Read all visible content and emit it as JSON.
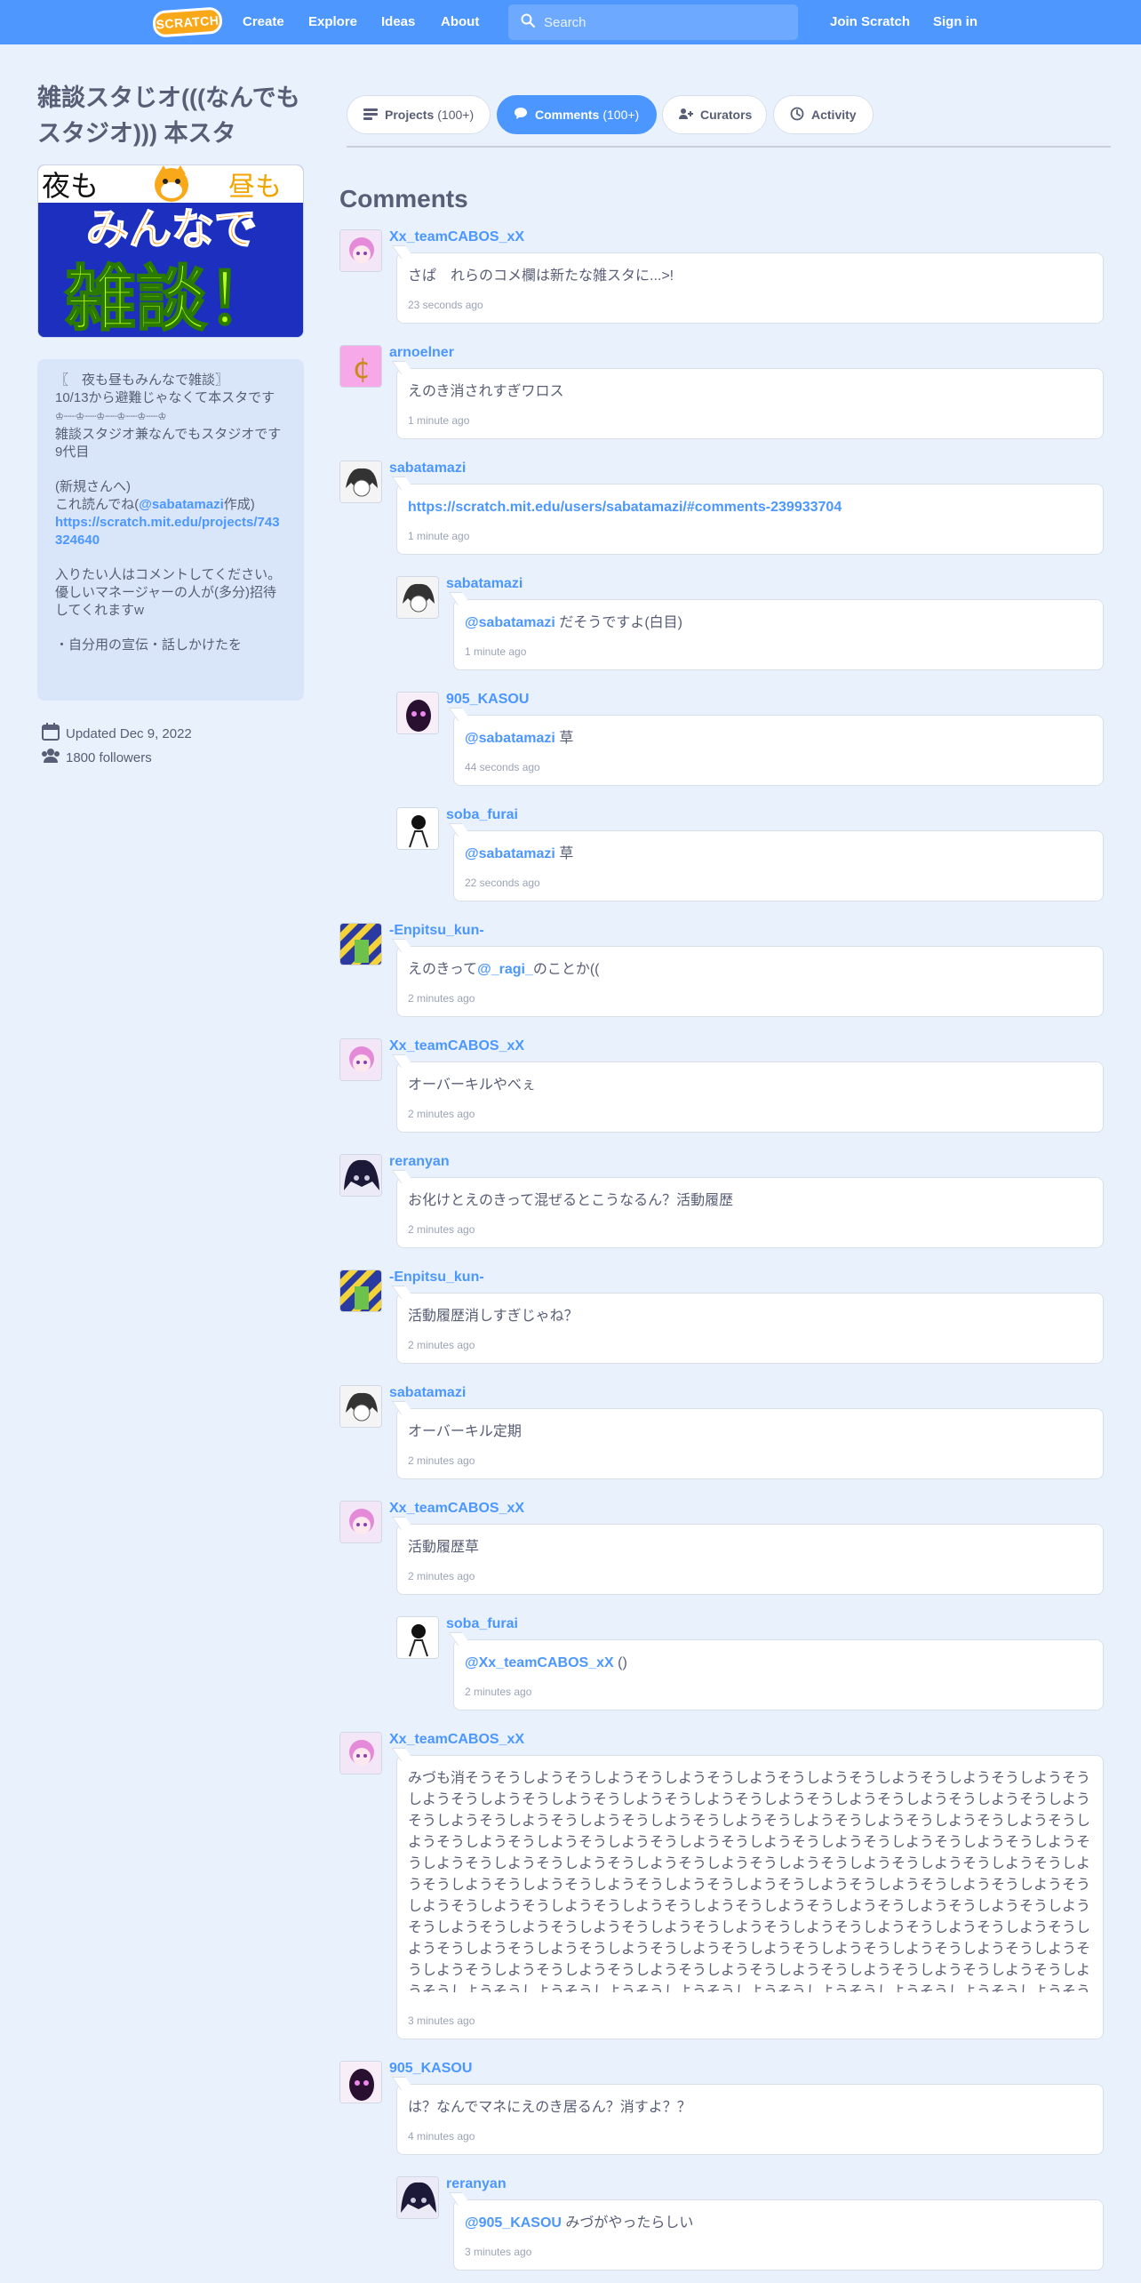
{
  "nav": {
    "logo": "SCRATCH",
    "create": "Create",
    "explore": "Explore",
    "ideas": "Ideas",
    "about": "About",
    "search_placeholder": "Search",
    "join": "Join Scratch",
    "signin": "Sign in"
  },
  "studio": {
    "title": "雑談スタじオ(((なんでもスタジオ))) 本スタ",
    "thumbnail_text": {
      "top_left": "夜も",
      "top_right": "昼も",
      "middle": "みんなで",
      "bottom": "雑談！"
    },
    "description": {
      "p1_line1": "〖　夜も昼もみんなで雑談〗",
      "p1_line2": "10/13から避難じゃなくて本スタです",
      "p1_line3": "♔┈┈♔┈┈♔┈┈♔┈┈♔┈┈♔",
      "p1_line4": "雑談スタジオ兼なんでもスタジオです",
      "p1_line5": "9代目",
      "p2_line1": "(新規さんへ)",
      "p2_prefix": "これ読んでね(",
      "p2_mention": "@sabatamazi",
      "p2_suffix": "作成)",
      "p2_link": "https://scratch.mit.edu/projects/743324640",
      "p3_line1": "入りたい人はコメントしてください。",
      "p3_line2": "優しいマネージャーの人が(多分)招待してくれますw",
      "p4_line1": "・自分用の宣伝・話しかけたを"
    },
    "updated": "Updated Dec 9, 2022",
    "followers": "1800 followers"
  },
  "tabs": [
    {
      "label": "Projects",
      "count": "(100+)"
    },
    {
      "label": "Comments",
      "count": "(100+)"
    },
    {
      "label": "Curators",
      "count": ""
    },
    {
      "label": "Activity",
      "count": ""
    }
  ],
  "comments_heading": "Comments",
  "comments": [
    {
      "user": "Xx_teamCABOS_xX",
      "text": "さぱ　れらのコメ欄は新たな雑スタに...>!",
      "time": "23 seconds ago"
    },
    {
      "user": "arnoelner",
      "text": "えのき消されすぎワロス",
      "time": "1 minute ago"
    },
    {
      "user": "sabatamazi",
      "text": "",
      "link": "https://scratch.mit.edu/users/sabatamazi/#comments-239933704",
      "time": "1 minute ago"
    },
    {
      "user": "sabatamazi",
      "mention": "@sabatamazi",
      "text": " だそうですよ(白目)",
      "time": "1 minute ago"
    },
    {
      "user": "905_KASOU",
      "mention": "@sabatamazi",
      "text": " 草",
      "time": "44 seconds ago"
    },
    {
      "user": "soba_furai",
      "mention": "@sabatamazi",
      "text": " 草",
      "time": "22 seconds ago"
    },
    {
      "user": "-Enpitsu_kun-",
      "text": "えのきって",
      "mention": "@_ragi_",
      "text_after": "のことか((",
      "time": "2 minutes ago"
    },
    {
      "user": "Xx_teamCABOS_xX",
      "text": "オーバーキルやべぇ",
      "time": "2 minutes ago"
    },
    {
      "user": "reranyan",
      "text": "お化けとえのきって混ぜるとこうなるん？活動履歴",
      "time": "2 minutes ago"
    },
    {
      "user": "-Enpitsu_kun-",
      "text": "活動履歴消しすぎじゃね？",
      "time": "2 minutes ago"
    },
    {
      "user": "sabatamazi",
      "text": "オーバーキル定期",
      "time": "2 minutes ago"
    },
    {
      "user": "Xx_teamCABOS_xX",
      "text": "活動履歴草",
      "time": "2 minutes ago"
    },
    {
      "user": "soba_furai",
      "mention": "@Xx_teamCABOS_xX",
      "text": " ()",
      "time": "2 minutes ago"
    },
    {
      "user": "Xx_teamCABOS_xX",
      "text": "みづも消そうそうしようそうしようそうしようそうしようそうしようそうしようそうしようそうしようそうしようそうしようそうしようそうしようそうしようそうしようそうしようそうしようそうしようそうしようそうしようそうしようそうしようそうしようそうしようそうしようそうしようそうしようそうしようそうしようそうしようそうしようそうしようそうしようそうしようそうしようそうしようそうしようそうしようそうしようそうしようそうしようそうしようそうしようそうしようそうしようそうしようそうしようそうしようそうしようそうしようそうしようそうしようそうしようそうしようそうしようそうしようそうしようそうしようそうしようそうしようそうしようそうしようそうしようそうしようそうしようそうしようそうしようそうしようそうしようそうしようそうしようそうしようそうしようそうしようそうしようそうしようそうしようそうしようそうしようそうしようそうしようそうしようそうしようそうしようそうしようそうしようそうしようそうしようそうしようそうしようそうしようそうしようそうしようそうしようそうしようそうしようそうしようそうしようそうしようそうしようそうしようそうしようそうしようそうしようそうしようそうしようそうしようそうしようそうしようそうしようそうしようそうしようそうしようそうしようそうしようそうしよ",
      "time": "3 minutes ago"
    },
    {
      "user": "905_KASOU",
      "text": "は？なんでマネにえのき居るん？消すよ？？",
      "time": "4 minutes ago"
    },
    {
      "user": "reranyan",
      "mention": "@905_KASOU",
      "text": " みづがやったらしい",
      "time": "3 minutes ago"
    }
  ],
  "colors": {
    "nav": "#4d97ff",
    "link": "#4c97ff",
    "page_bg": "#e9f1fc",
    "text": "#575e75"
  }
}
